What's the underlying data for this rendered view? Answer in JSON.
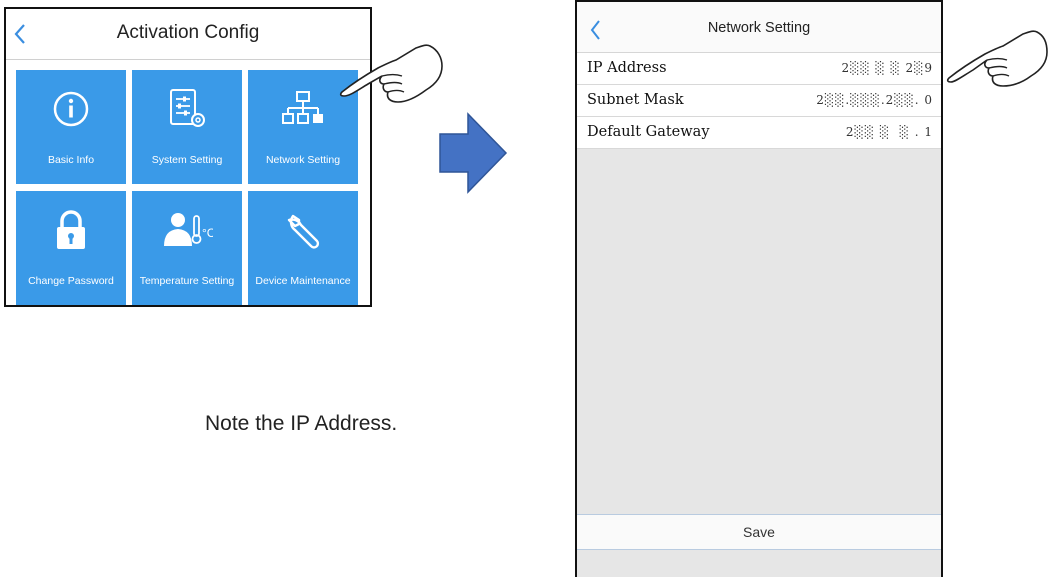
{
  "activation_config": {
    "title": "Activation Config",
    "tiles": [
      {
        "label": "Basic Info",
        "icon": "info-icon"
      },
      {
        "label": "System Setting",
        "icon": "settings-sliders-icon"
      },
      {
        "label": "Network Setting",
        "icon": "network-icon"
      },
      {
        "label": "Change Password",
        "icon": "lock-icon"
      },
      {
        "label": "Temperature Setting",
        "icon": "person-thermometer-icon"
      },
      {
        "label": "Device Maintenance",
        "icon": "wrench-icon"
      }
    ]
  },
  "note": "Note the IP Address.",
  "network_setting": {
    "title": "Network Setting",
    "rows": [
      {
        "label": "IP Address",
        "value": "2░░ ░ ░ 2░9"
      },
      {
        "label": "Subnet Mask",
        "value": "2░░.░░░.2░░. 0"
      },
      {
        "label": "Default Gateway",
        "value": "2░░ ░  ░ . 1"
      }
    ],
    "save_label": "Save"
  },
  "colors": {
    "tile_blue": "#3a9ae8",
    "back_chevron": "#3a8ee0",
    "arrow_fill": "#4472c4"
  }
}
